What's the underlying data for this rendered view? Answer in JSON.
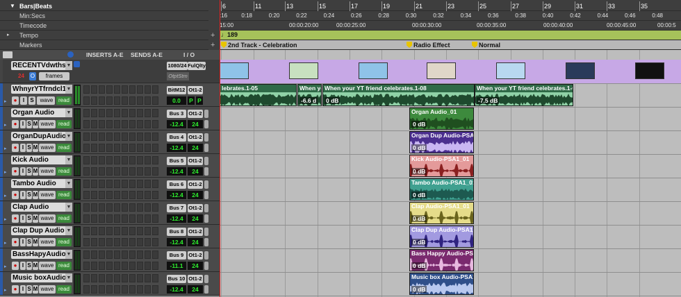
{
  "rulers": {
    "bars_label": "Bars|Beats",
    "minsecs_label": "Min:Secs",
    "timecode_label": "Timecode",
    "tempo_label": "Tempo",
    "markers_label": "Markers",
    "bars": [
      "6",
      "11",
      "13",
      "15",
      "17",
      "19",
      "21",
      "23",
      "25",
      "27",
      "29",
      "31",
      "33",
      "35"
    ],
    "minsecs": [
      ":16",
      "0:18",
      "0:20",
      "0:22",
      "0:24",
      "0:26",
      "0:28",
      "0:30",
      "0:32",
      "0:34",
      "0:36",
      "0:38",
      "0:40",
      "0:42",
      "0:44",
      "0:46",
      "0:48"
    ],
    "timecode": [
      "15:00",
      "00:00:20:00",
      "00:00:25:00",
      "00:00:30:00",
      "00:00:35:00",
      "00:00:40:00",
      "00:00:45:00",
      "00:00:5"
    ],
    "tempo": "189",
    "markers": [
      "2nd Track - Celebration",
      "Radio Effect",
      "Normal"
    ]
  },
  "header": {
    "inserts": "INSERTS A-E",
    "sends": "SENDS A-E",
    "io": "I / O"
  },
  "video_track": {
    "name": "RECENTVdwths",
    "count": "24",
    "unit": "frames",
    "io1": "1080/24",
    "io2": "FulQlty",
    "io3": "OtptStm"
  },
  "dialog_track": {
    "name": "WhnyrYTfrndcl1",
    "io1": "BitM12",
    "io2": "Ot1-2",
    "vol": "0.0",
    "pan1": "P",
    "pan2": "P"
  },
  "buttons": {
    "i": "I",
    "s": "S",
    "m": "M",
    "wave": "wave",
    "read": "read"
  },
  "tracks": [
    {
      "name": "Organ Audio",
      "bus": "Bus 3",
      "out": "Ot1-2",
      "vol": "-12.4",
      "pan": "24",
      "clip": "Organ Audio_01",
      "gain": "0 dB",
      "color": "#3d8a3d",
      "wave": "#1f4f1f"
    },
    {
      "name": "OrganDupAudio",
      "bus": "Bus 4",
      "out": "Ot1-2",
      "vol": "-12.4",
      "pan": "24",
      "clip": "Organ Dup Audio-PSA1",
      "gain": "0 dB",
      "color": "#4b2f8f",
      "wave": "#c9b6f2"
    },
    {
      "name": "Kick Audio",
      "bus": "Bus 5",
      "out": "Ot1-2",
      "vol": "-12.4",
      "pan": "24",
      "clip": "Kick Audio-PSA1_01",
      "gain": "0 dB",
      "color": "#e49a9a",
      "wave": "#8a2020"
    },
    {
      "name": "Tambo Audio",
      "bus": "Bus 6",
      "out": "Ot1-2",
      "vol": "-12.4",
      "pan": "24",
      "clip": "Tambo Audio-PSA1_01",
      "gain": "0 dB",
      "color": "#3fa090",
      "wave": "#1d5a50"
    },
    {
      "name": "Clap Audio",
      "bus": "Bus 7",
      "out": "Ot1-2",
      "vol": "-12.4",
      "pan": "24",
      "clip": "Clap Audio-PSA1_01",
      "gain": "0 dB",
      "color": "#e5dc8a",
      "wave": "#6a641d"
    },
    {
      "name": "Clap Dup Audio",
      "bus": "Bus 8",
      "out": "Ot1-2",
      "vol": "-12.4",
      "pan": "24",
      "clip": "Clap Dup Audio-PSA1_",
      "gain": "0 dB",
      "color": "#a29ae0",
      "wave": "#2f2380"
    },
    {
      "name": "BassHapyAudio",
      "bus": "Bus 9",
      "out": "Ot1-2",
      "vol": "-11.1",
      "pan": "24",
      "clip": "Bass Happy Audio-PSA",
      "gain": "0 dB",
      "color": "#7a2a6e",
      "wave": "#e7b8df"
    },
    {
      "name": "Music boxAudio",
      "bus": "Bus 10",
      "out": "Ot1-2",
      "vol": "-12.4",
      "pan": "24",
      "clip": "Music box Audio-PSA1",
      "gain": "0 dB",
      "color": "#2f4f8a",
      "wave": "#b8c8ef"
    }
  ],
  "dialog_clips": [
    {
      "name": "lebrates.1-05",
      "gain": ""
    },
    {
      "name": "When yo",
      "gain": "-6.6 d"
    },
    {
      "name": "When your YT friend celebrates.1-08",
      "gain": "0 dB"
    },
    {
      "name": "When your YT friend celebrates.1-09",
      "gain": "-7.5 dB"
    }
  ],
  "colors": {
    "video_lane": "#c7a8e6",
    "dialog_clip": "#8fd1a6",
    "ruler_bg": "#3e3e3e",
    "tempo_lane": "#a6c25a",
    "marker_lane": "#b8b8b8"
  }
}
